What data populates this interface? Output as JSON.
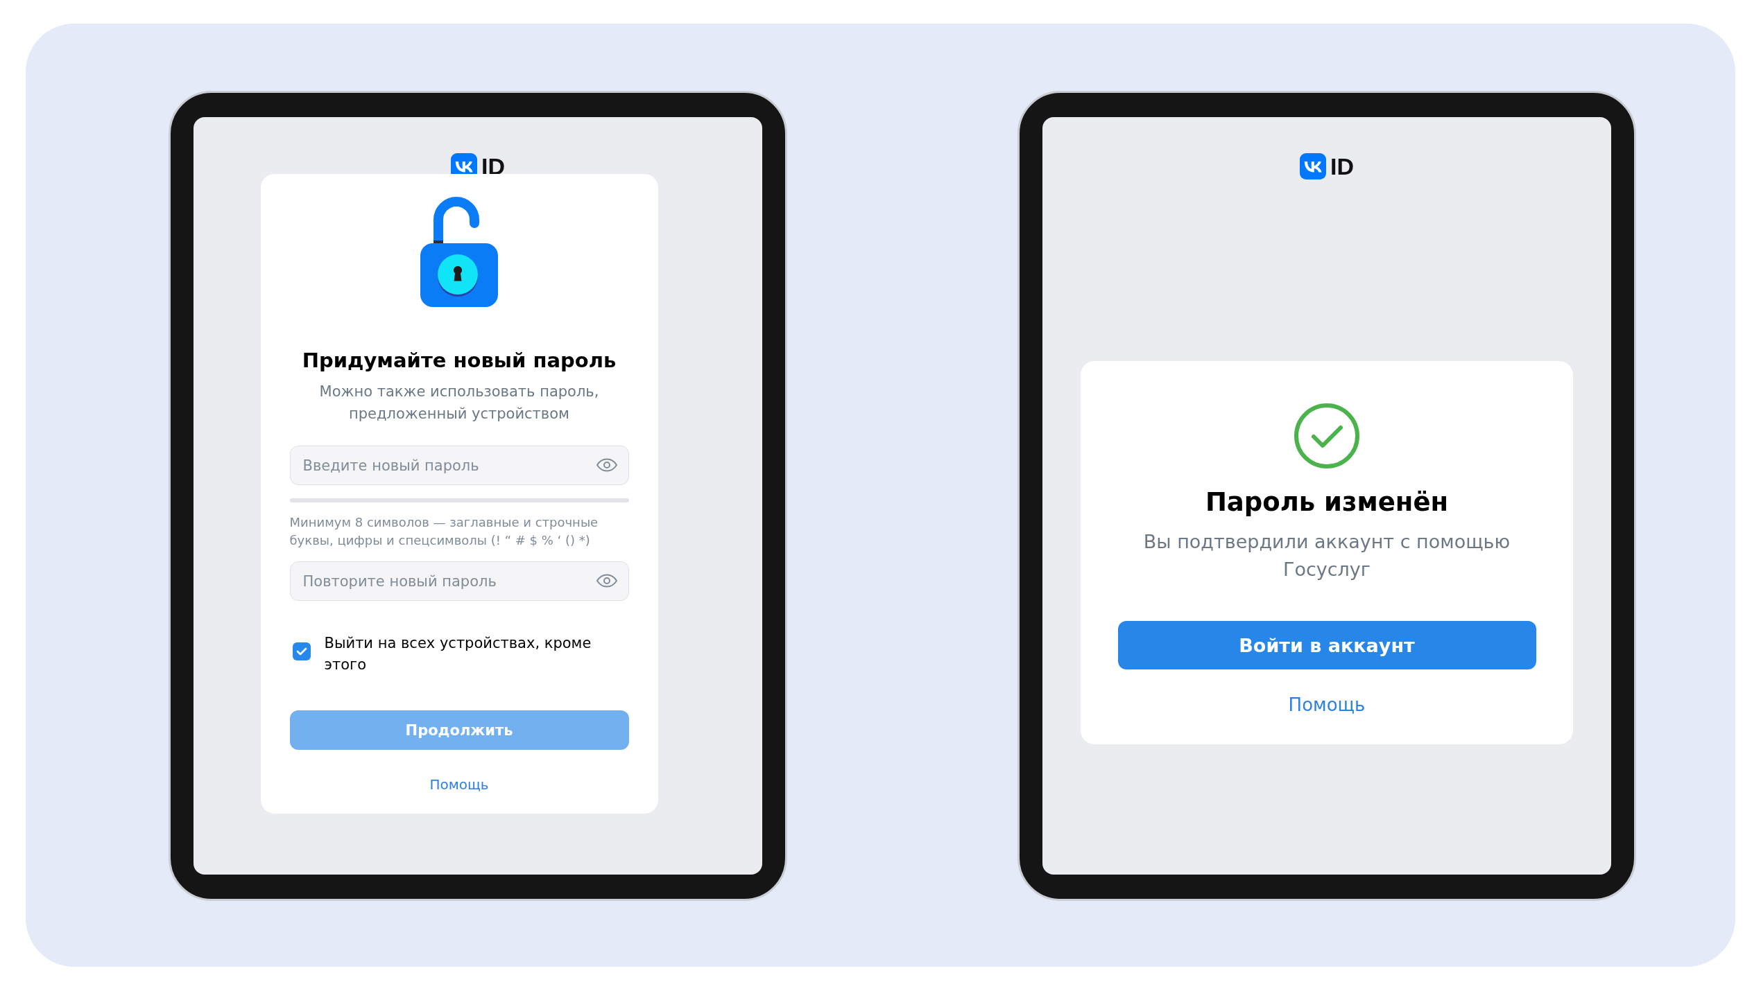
{
  "screens": [
    {
      "kind": "new_password",
      "logo": "ID",
      "title": "Придумайте новый пароль",
      "subtitle": "Можно также использовать пароль, предложенный устройством",
      "fields": [
        {
          "placeholder": "Введите новый пароль"
        },
        {
          "placeholder": "Повторите новый пароль"
        }
      ],
      "hint": "Минимум 8 символов — заглавные и строчные буквы, цифры и спецсимволы (! “ # $ % ‘ () *)",
      "checkbox": {
        "label": "Выйти на всех устройствах, кроме этого",
        "checked": true
      },
      "button": {
        "label": "Продолжить",
        "disabled": true
      },
      "help": "Помощь"
    },
    {
      "kind": "success",
      "logo": "ID",
      "title": "Пароль изменён",
      "subtitle": "Вы подтвердили аккаунт с помощью Госуслуг",
      "button": {
        "label": "Войти в аккаунт",
        "disabled": false
      },
      "help": "Помощь"
    }
  ]
}
